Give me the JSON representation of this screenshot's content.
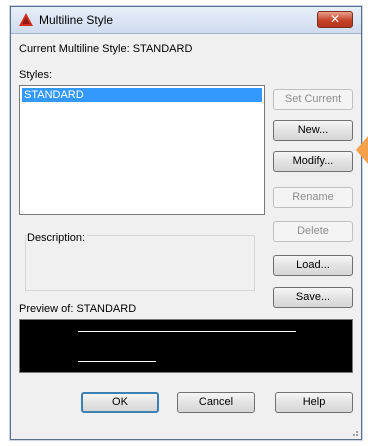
{
  "window": {
    "title": "Multiline Style",
    "close_glyph": "✕",
    "icon": "autocad-logo-icon",
    "accent_color": "#c7432a"
  },
  "current_style": {
    "label": "Current Multiline Style: STANDARD"
  },
  "styles": {
    "label": "Styles:",
    "items": [
      "STANDARD"
    ],
    "selected": "STANDARD",
    "selection_color": "#3399ff"
  },
  "buttons": {
    "set_current": "Set Current",
    "new": "New...",
    "modify": "Modify...",
    "rename": "Rename",
    "delete": "Delete",
    "load": "Load...",
    "save": "Save...",
    "ok": "OK",
    "cancel": "Cancel",
    "help": "Help"
  },
  "description": {
    "label": "Description:",
    "value": ""
  },
  "preview": {
    "label": "Preview of: STANDARD",
    "background": "#000000",
    "line_color": "#ffffff"
  }
}
